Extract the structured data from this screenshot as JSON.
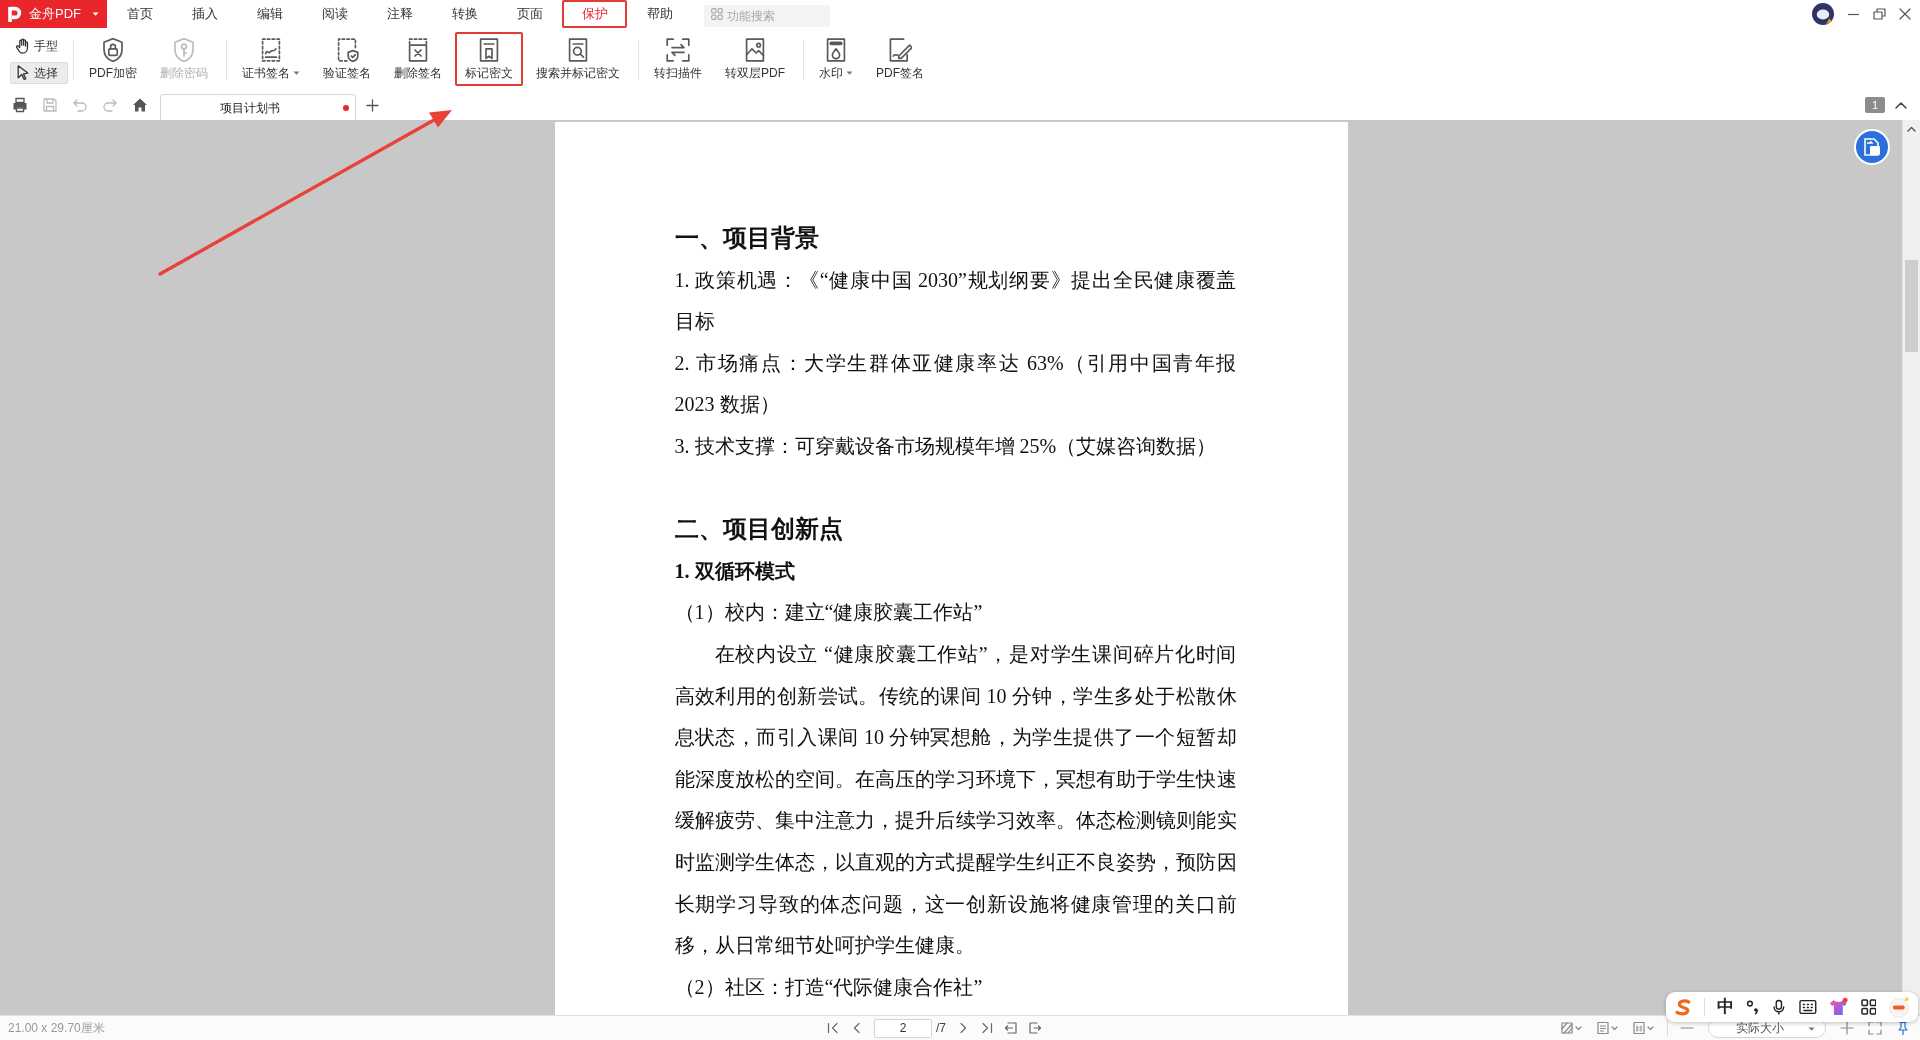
{
  "app_menu": {
    "logo_text": "金舟PDF"
  },
  "menu": [
    {
      "label": "首页",
      "selected": false,
      "annotated": false
    },
    {
      "label": "插入",
      "selected": false,
      "annotated": false
    },
    {
      "label": "编辑",
      "selected": false,
      "annotated": false
    },
    {
      "label": "阅读",
      "selected": false,
      "annotated": false
    },
    {
      "label": "注释",
      "selected": false,
      "annotated": false
    },
    {
      "label": "转换",
      "selected": false,
      "annotated": false
    },
    {
      "label": "页面",
      "selected": false,
      "annotated": false
    },
    {
      "label": "保护",
      "selected": true,
      "annotated": true
    },
    {
      "label": "帮助",
      "selected": false,
      "annotated": false
    }
  ],
  "search": {
    "placeholder": "功能搜索"
  },
  "toolbar": {
    "modes": [
      {
        "label": "手型",
        "selected": false
      },
      {
        "label": "选择",
        "selected": true
      }
    ],
    "groups": [
      [
        {
          "label": "PDF加密",
          "disabled": false,
          "has_menu": false,
          "annotated": false
        },
        {
          "label": "删除密码",
          "disabled": true,
          "has_menu": false,
          "annotated": false
        }
      ],
      [
        {
          "label": "证书签名",
          "disabled": false,
          "has_menu": true,
          "annotated": false
        },
        {
          "label": "验证签名",
          "disabled": false,
          "has_menu": false,
          "annotated": false
        },
        {
          "label": "删除签名",
          "disabled": false,
          "has_menu": false,
          "annotated": false
        },
        {
          "label": "标记密文",
          "disabled": false,
          "has_menu": false,
          "annotated": true
        },
        {
          "label": "搜索并标记密文",
          "disabled": false,
          "has_menu": false,
          "annotated": false
        }
      ],
      [
        {
          "label": "转扫描件",
          "disabled": false,
          "has_menu": false,
          "annotated": false
        },
        {
          "label": "转双层PDF",
          "disabled": false,
          "has_menu": false,
          "annotated": false
        }
      ],
      [
        {
          "label": "水印",
          "disabled": false,
          "has_menu": true,
          "annotated": false
        },
        {
          "label": "PDF签名",
          "disabled": false,
          "has_menu": false,
          "annotated": false
        }
      ]
    ]
  },
  "quick_actions": [
    {
      "disabled": false
    },
    {
      "disabled": true
    },
    {
      "disabled": true
    },
    {
      "disabled": true
    },
    {
      "disabled": false
    }
  ],
  "tabs": [
    {
      "title": "项目计划书",
      "selected": true,
      "modified": true
    }
  ],
  "page_badge": "1",
  "document": {
    "blocks": [
      {
        "kind": "heading",
        "text": "一、项目背景"
      },
      {
        "kind": "item",
        "text": "1. 政策机遇：《“健康中国 2030”规划纲要》提出全民健康覆盖目标"
      },
      {
        "kind": "item",
        "text": "2. 市场痛点：大学生群体亚健康率达 63%（引用中国青年报 2023 数据）"
      },
      {
        "kind": "item",
        "text": "3. 技术支撑：可穿戴设备市场规模年增 25%（艾媒咨询数据）"
      },
      {
        "kind": "heading",
        "text": "二、项目创新点"
      },
      {
        "kind": "subheading",
        "text": "1. 双循环模式"
      },
      {
        "kind": "item",
        "text": "（1）校内：建立“健康胶囊工作站”"
      },
      {
        "kind": "paragraph",
        "text": "在校内设立 “健康胶囊工作站”，是对学生课间碎片化时间高效利用的创新尝试。传统的课间 10 分钟，学生多处于松散休息状态，而引入课间 10 分钟冥想舱，为学生提供了一个短暂却能深度放松的空间。在高压的学习环境下，冥想有助于学生快速缓解疲劳、集中注意力，提升后续学习效率。体态检测镜则能实时监测学生体态，以直观的方式提醒学生纠正不良姿势，预防因长期学习导致的体态问题，这一创新设施将健康管理的关口前移，从日常细节处呵护学生健康。"
      },
      {
        "kind": "item",
        "text": "（2）社区：打造“代际健康合作社”"
      }
    ]
  },
  "status_bar": {
    "page_size": "21.00 x 29.70厘米",
    "page": "2",
    "page_total": "/7",
    "zoom": "实际大小"
  },
  "ime_toolbar": {
    "mode": "中"
  }
}
